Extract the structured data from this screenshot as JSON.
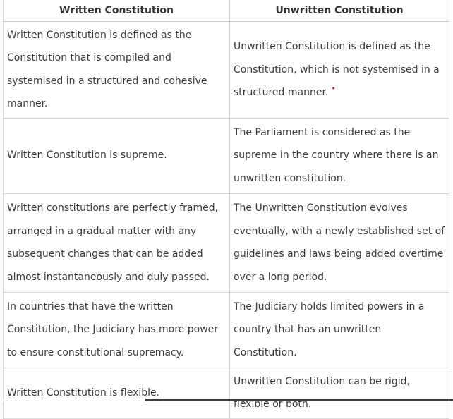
{
  "table": {
    "headers": [
      "Written Constitution",
      "Unwritten Constitution"
    ],
    "rows": [
      {
        "written": "Written Constitution is defined as the Constitution that is compiled and systemised in a structured and cohesive manner.",
        "unwritten": "Unwritten Constitution is defined as the Constitution, which is not systemised in a structured manner.",
        "unwritten_marker": "•"
      },
      {
        "written": "Written Constitution is supreme.",
        "unwritten": "The Parliament is considered as the supreme in the country where there is an unwritten constitution."
      },
      {
        "written": "Written constitutions are perfectly framed, arranged in a gradual matter with any subsequent changes that can be added almost instantaneously and duly passed.",
        "unwritten": "The Unwritten Constitution evolves eventually, with a newly established set of guidelines and laws being added overtime over a long period."
      },
      {
        "written": "In countries that have the written Constitution, the Judiciary has more power to ensure constitutional supremacy.",
        "unwritten": "The Judiciary holds limited powers in a country that has an unwritten Constitution."
      },
      {
        "written": "Written Constitution is flexible.",
        "unwritten": "Unwritten Constitution can be rigid, flexible or both."
      }
    ]
  },
  "colors": {
    "border": "#d4d4d4",
    "text": "#3a3a3a",
    "marker": "#e0202a",
    "scrollbar_thumb": "#3d3d3d"
  }
}
